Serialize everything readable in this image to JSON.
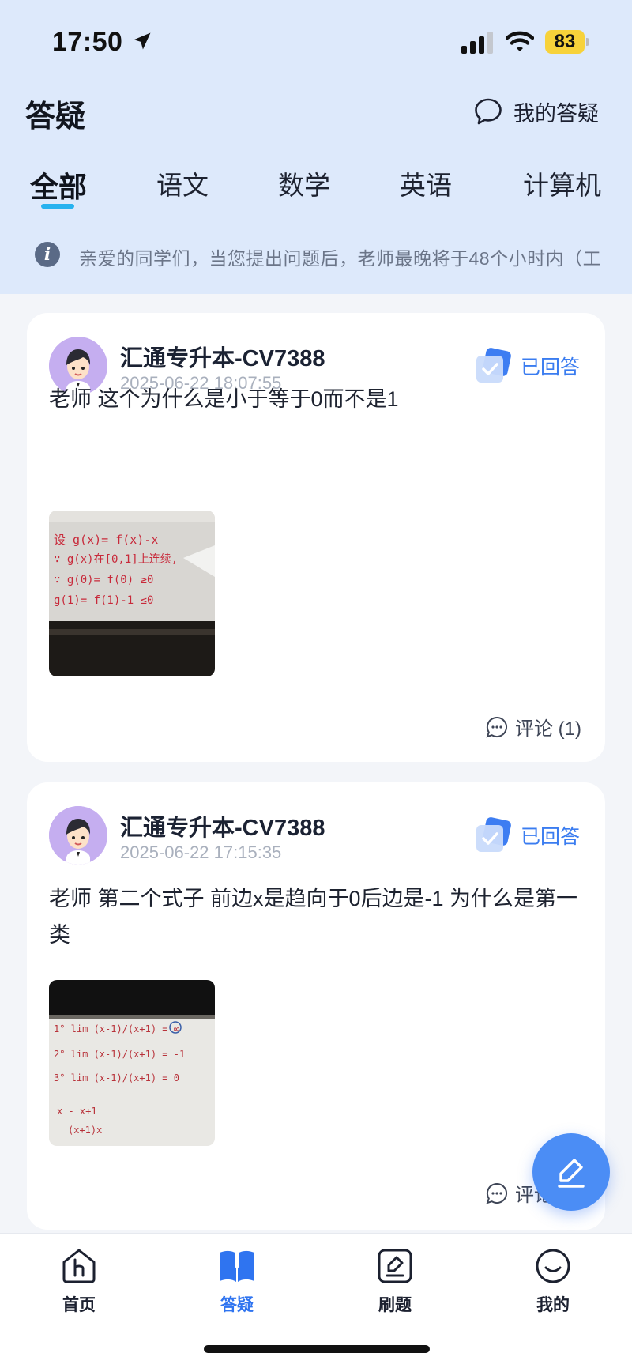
{
  "status_bar": {
    "time": "17:50",
    "battery": "83"
  },
  "header": {
    "title": "答疑",
    "my_questions_label": "我的答疑"
  },
  "tabs": [
    {
      "label": "全部",
      "active": true
    },
    {
      "label": "语文",
      "active": false
    },
    {
      "label": "数学",
      "active": false
    },
    {
      "label": "英语",
      "active": false
    },
    {
      "label": "计算机",
      "active": false
    }
  ],
  "notice": {
    "text": "亲爱的同学们，当您提出问题后，老师最晚将于48个小时内（工"
  },
  "posts": [
    {
      "user": "汇通专升本-CV7388",
      "time": "2025-06-22 18:07:55",
      "status": "已回答",
      "question": "老师 这个为什么是小于等于0而不是1",
      "comments": "评论 (1)",
      "image_lines": [
        "设 g(x)= f(x)-x",
        "∵ g(x)在[0,1]上连续,",
        "∵ g(0)= f(0) ≥0",
        "g(1)= f(1)-1 ≤0"
      ]
    },
    {
      "user": "汇通专升本-CV7388",
      "time": "2025-06-22 17:15:35",
      "status": "已回答",
      "question": "老师 第二个式子 前边x是趋向于0后边是-1 为什么是第一类",
      "comments": "评论 (2)",
      "image_lines": [
        "1° lim (x-1)/(x+1) = ∞",
        "2° lim (x-1)/(x+1) = -1",
        "3° lim (x-1)/(x+1) = 0",
        "x - x+1",
        "(x+1)x"
      ]
    }
  ],
  "bottom_nav": [
    {
      "label": "首页",
      "icon": "home-icon",
      "active": false
    },
    {
      "label": "答疑",
      "icon": "book-icon",
      "active": true
    },
    {
      "label": "刷题",
      "icon": "edit-box-icon",
      "active": false
    },
    {
      "label": "我的",
      "icon": "smile-icon",
      "active": false
    }
  ],
  "colors": {
    "accent": "#2f74f0",
    "header_bg": "#dde9fb",
    "tab_indicator": "#27b2ef",
    "fab": "#4b8df5"
  }
}
